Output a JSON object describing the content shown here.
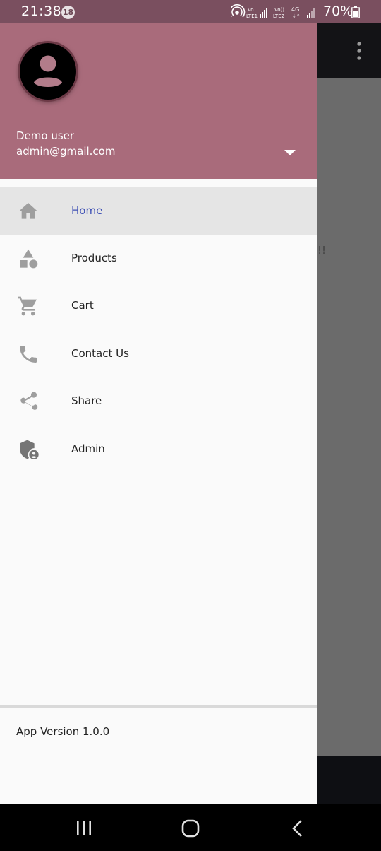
{
  "status_bar": {
    "time": "21:38",
    "badge": "18",
    "battery": "70%"
  },
  "drawer": {
    "user_name": "Demo user",
    "user_email": "admin@gmail.com",
    "items": [
      {
        "label": "Home",
        "icon": "home-icon",
        "selected": true
      },
      {
        "label": "Products",
        "icon": "category-icon"
      },
      {
        "label": "Cart",
        "icon": "cart-icon"
      },
      {
        "label": "Contact Us",
        "icon": "phone-icon"
      },
      {
        "label": "Share",
        "icon": "share-icon"
      },
      {
        "label": "Admin",
        "icon": "admin-shield-icon"
      }
    ],
    "footer": "App Version 1.0.0"
  },
  "background_app": {
    "visible_text": "!!"
  },
  "colors": {
    "header": "#a96b7b",
    "selected_label": "#3f51b5",
    "icon_gray": "#9e9e9e"
  }
}
